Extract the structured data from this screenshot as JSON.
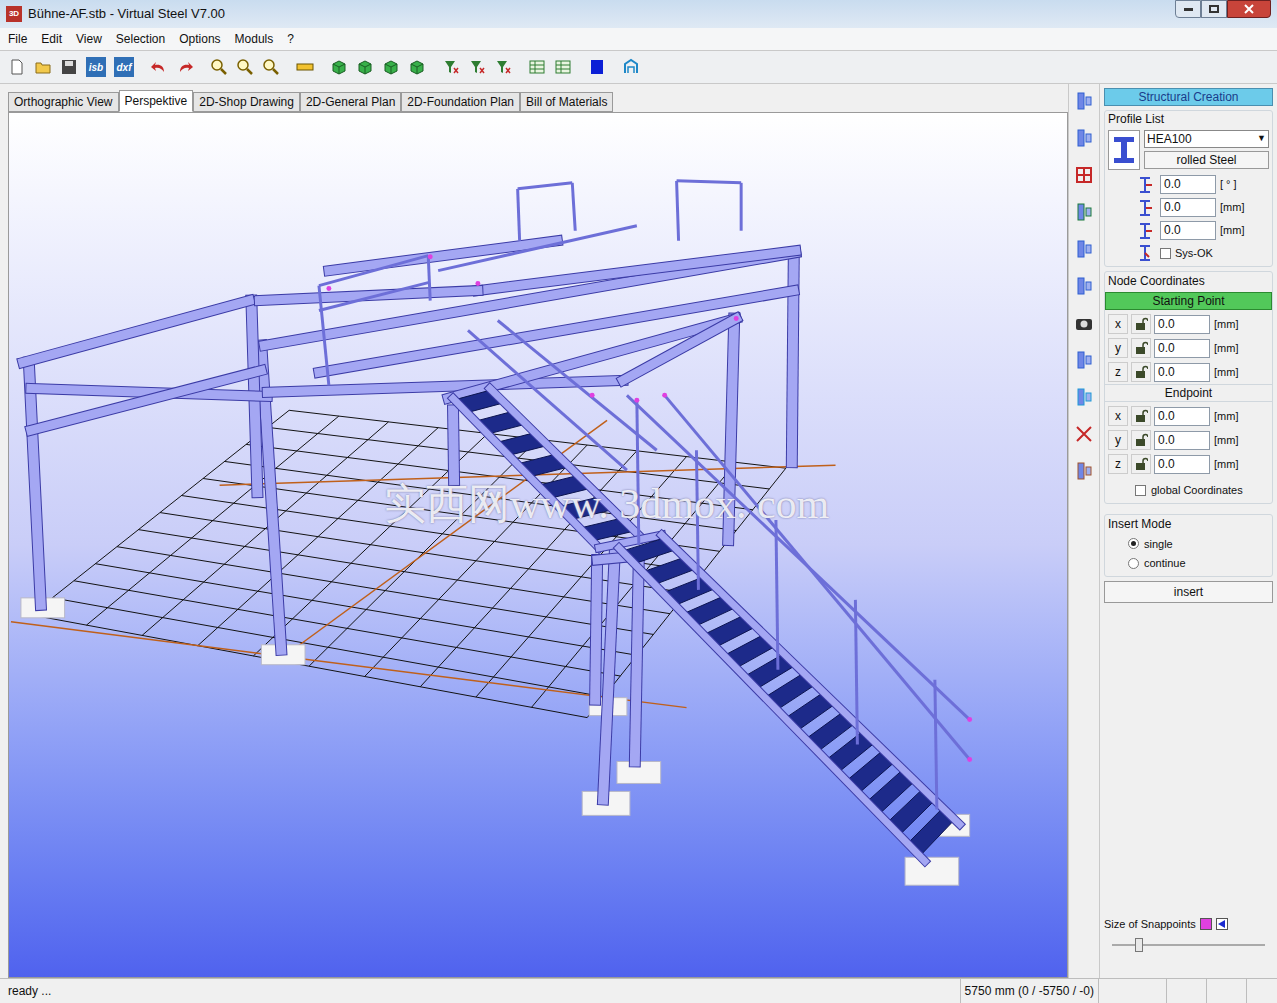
{
  "window": {
    "title": "Bühne-AF.stb  - Virtual Steel V7.00",
    "app_icon": "3D"
  },
  "menu": [
    "File",
    "Edit",
    "View",
    "Selection",
    "Options",
    "Moduls",
    "?"
  ],
  "toolbar": {
    "text_buttons": [
      "isb",
      "dxf"
    ]
  },
  "tabs": [
    {
      "label": "Orthographic View",
      "selected": false
    },
    {
      "label": "Perspektive",
      "selected": true
    },
    {
      "label": "2D-Shop Drawing",
      "selected": false
    },
    {
      "label": "2D-General Plan",
      "selected": false
    },
    {
      "label": "2D-Foundation Plan",
      "selected": false
    },
    {
      "label": "Bill of Materials",
      "selected": false
    }
  ],
  "viewport": {
    "watermark": "实西网www. 3dmox. com"
  },
  "panel": {
    "header": "Structural Creation",
    "profile_list": {
      "title": "Profile List",
      "profile": "HEA100",
      "material": "rolled Steel",
      "fields": [
        {
          "value": "0.0",
          "unit": "[ ° ]"
        },
        {
          "value": "0.0",
          "unit": "[mm]"
        },
        {
          "value": "0.0",
          "unit": "[mm]"
        }
      ],
      "sys_ok": {
        "label": "Sys-OK",
        "checked": false
      }
    },
    "node_coordinates": {
      "title": "Node Coordinates",
      "points": [
        {
          "title": "Starting Point",
          "selected": true,
          "fields": [
            {
              "axis": "x",
              "value": "0.0",
              "unit": "[mm]"
            },
            {
              "axis": "y",
              "value": "0.0",
              "unit": "[mm]"
            },
            {
              "axis": "z",
              "value": "0.0",
              "unit": "[mm]"
            }
          ]
        },
        {
          "title": "Endpoint",
          "selected": false,
          "fields": [
            {
              "axis": "x",
              "value": "0.0",
              "unit": "[mm]"
            },
            {
              "axis": "y",
              "value": "0.0",
              "unit": "[mm]"
            },
            {
              "axis": "z",
              "value": "0.0",
              "unit": "[mm]"
            }
          ]
        }
      ],
      "global": {
        "label": "global Coordinates",
        "checked": false
      }
    },
    "insert_mode": {
      "title": "Insert Mode",
      "options": [
        {
          "label": "single",
          "selected": true
        },
        {
          "label": "continue",
          "selected": false
        }
      ]
    },
    "insert_button": "insert",
    "snappoints": {
      "label": "Size of Snappoints",
      "level": 0.15
    }
  },
  "status_bar": [
    "ready ...",
    "5750 mm (0 / -5750 / -0)"
  ]
}
